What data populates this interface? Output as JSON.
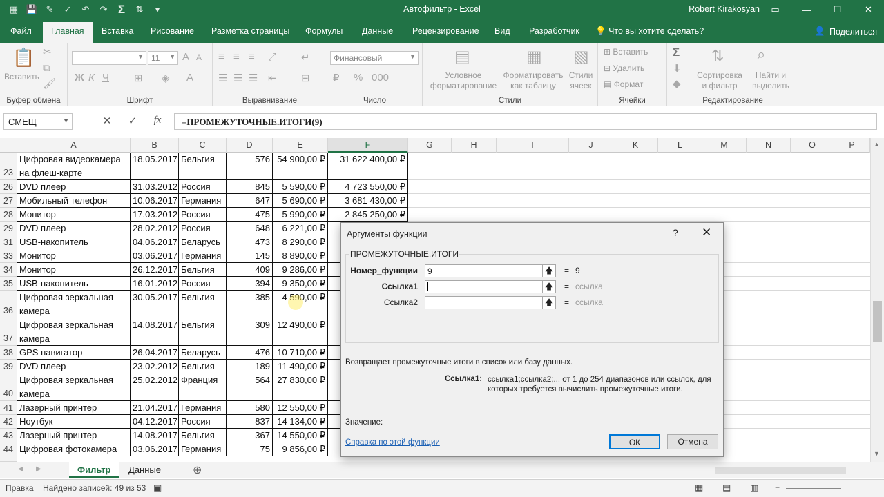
{
  "window": {
    "title": "Автофильтр  -  Excel",
    "user": "Robert Kirakosyan",
    "qat_icons": [
      "grid-icon",
      "save-icon",
      "pin-icon",
      "check-icon",
      "undo-icon",
      "redo-icon",
      "sum-icon",
      "sort-icon",
      "customize-icon"
    ]
  },
  "ribbon_tabs": [
    "Файл",
    "Главная",
    "Вставка",
    "Рисование",
    "Разметка страницы",
    "Формулы",
    "Данные",
    "Рецензирование",
    "Вид",
    "Разработчик"
  ],
  "active_tab": "Главная",
  "tell_me": "Что вы хотите сделать?",
  "share": "Поделиться",
  "ribbon": {
    "clipboard": {
      "label": "Буфер обмена",
      "paste": "Вставить"
    },
    "font": {
      "label": "Шрифт",
      "size": "11",
      "bold": "Ж",
      "italic": "К",
      "underline": "Ч"
    },
    "alignment": {
      "label": "Выравнивание"
    },
    "number": {
      "label": "Число",
      "format": "Финансовый"
    },
    "styles": {
      "label": "Стили",
      "cond1": "Условное",
      "cond2": "форматирование",
      "table1": "Форматировать",
      "table2": "как таблицу",
      "cell1": "Стили",
      "cell2": "ячеек"
    },
    "cells": {
      "label": "Ячейки",
      "insert": "Вставить",
      "delete": "Удалить",
      "format": "Формат"
    },
    "editing": {
      "label": "Редактирование",
      "sort1": "Сортировка",
      "sort2": "и фильтр",
      "find1": "Найти и",
      "find2": "выделить"
    }
  },
  "formula_bar": {
    "name_box": "СМЕЩ",
    "cancel": "✕",
    "enter": "✓",
    "fx": "fx",
    "formula": "=ПРОМЕЖУТОЧНЫЕ.ИТОГИ(9)"
  },
  "columns": [
    "A",
    "B",
    "C",
    "D",
    "E",
    "F",
    "G",
    "H",
    "I",
    "J",
    "K",
    "L",
    "M",
    "N",
    "O",
    "P"
  ],
  "rows": [
    {
      "num": "23",
      "a1": "Цифровая видеокамера",
      "a2": "на флеш-карте",
      "b": "18.05.2017",
      "c": "Бельгия",
      "d": "576",
      "e": "54 900,00 ₽",
      "f": "31 622 400,00 ₽"
    },
    {
      "num": "26",
      "a1": "DVD плеер",
      "b": "31.03.2012",
      "c": "Россия",
      "d": "845",
      "e": "5 590,00 ₽",
      "f": "4 723 550,00 ₽"
    },
    {
      "num": "27",
      "a1": "Мобильный телефон",
      "b": "10.06.2017",
      "c": "Германия",
      "d": "647",
      "e": "5 690,00 ₽",
      "f": "3 681 430,00 ₽"
    },
    {
      "num": "28",
      "a1": "Монитор",
      "b": "17.03.2012",
      "c": "Россия",
      "d": "475",
      "e": "5 990,00 ₽",
      "f": "2 845 250,00 ₽"
    },
    {
      "num": "29",
      "a1": "DVD плеер",
      "b": "28.02.2012",
      "c": "Россия",
      "d": "648",
      "e": "6 221,00 ₽",
      "f": ""
    },
    {
      "num": "31",
      "a1": "USB-накопитель",
      "b": "04.06.2017",
      "c": "Беларусь",
      "d": "473",
      "e": "8 290,00 ₽",
      "f": ""
    },
    {
      "num": "33",
      "a1": "Монитор",
      "b": "03.06.2017",
      "c": "Германия",
      "d": "145",
      "e": "8 890,00 ₽",
      "f": ""
    },
    {
      "num": "34",
      "a1": "Монитор",
      "b": "26.12.2017",
      "c": "Бельгия",
      "d": "409",
      "e": "9 286,00 ₽",
      "f": ""
    },
    {
      "num": "35",
      "a1": "USB-накопитель",
      "b": "16.01.2012",
      "c": "Россия",
      "d": "394",
      "e": "9 350,00 ₽",
      "f": ""
    },
    {
      "num": "36",
      "a1": "Цифровая зеркальная",
      "a2": "камера",
      "b": "30.05.2017",
      "c": "Бельгия",
      "d": "385",
      "e": "4 590,00 ₽",
      "f": ""
    },
    {
      "num": "37",
      "a1": "Цифровая зеркальная",
      "a2": "камера",
      "b": "14.08.2017",
      "c": "Бельгия",
      "d": "309",
      "e": "12 490,00 ₽",
      "f": ""
    },
    {
      "num": "38",
      "a1": "GPS навигатор",
      "b": "26.04.2017",
      "c": "Беларусь",
      "d": "476",
      "e": "10 710,00 ₽",
      "f": ""
    },
    {
      "num": "39",
      "a1": "DVD плеер",
      "b": "23.02.2012",
      "c": "Бельгия",
      "d": "189",
      "e": "11 490,00 ₽",
      "f": ""
    },
    {
      "num": "40",
      "a1": "Цифровая зеркальная",
      "a2": "камера",
      "b": "25.02.2012",
      "c": "Франция",
      "d": "564",
      "e": "27 830,00 ₽",
      "f": ""
    },
    {
      "num": "41",
      "a1": "Лазерный принтер",
      "b": "21.04.2017",
      "c": "Германия",
      "d": "580",
      "e": "12 550,00 ₽",
      "f": ""
    },
    {
      "num": "42",
      "a1": "Ноутбук",
      "b": "04.12.2017",
      "c": "Россия",
      "d": "837",
      "e": "14 134,00 ₽",
      "f": ""
    },
    {
      "num": "43",
      "a1": "Лазерный принтер",
      "b": "14.08.2017",
      "c": "Бельгия",
      "d": "367",
      "e": "14 550,00 ₽",
      "f": ""
    },
    {
      "num": "44",
      "a1": "Цифровая фотокамера",
      "b": "03.06.2017",
      "c": "Германия",
      "d": "75",
      "e": "9 856,00 ₽",
      "f": ""
    }
  ],
  "sheets": [
    "Фильтр",
    "Данные"
  ],
  "active_sheet": "Фильтр",
  "status": {
    "mode": "Правка",
    "found": "Найдено записей: 49 из 53"
  },
  "dialog": {
    "title": "Аргументы функции",
    "help_glyph": "?",
    "close_glyph": "✕",
    "function_name": "ПРОМЕЖУТОЧНЫЕ.ИТОГИ",
    "args": [
      {
        "label": "Номер_функции",
        "value": "9",
        "result": "9"
      },
      {
        "label": "Ссылка1",
        "value": "",
        "result": "ссылка"
      },
      {
        "label": "Ссылка2",
        "value": "",
        "result": "ссылка"
      }
    ],
    "equals": "=",
    "description": "Возвращает промежуточные итоги в список или базу данных.",
    "arg_desc_label": "Ссылка1:",
    "arg_desc": "ссылка1;ссылка2;... от 1 до 254 диапазонов или ссылок, для которых требуется вычислить промежуточные итоги.",
    "value_label": "Значение:",
    "help_link": "Справка по этой функции",
    "ok": "ОК",
    "cancel": "Отмена"
  }
}
